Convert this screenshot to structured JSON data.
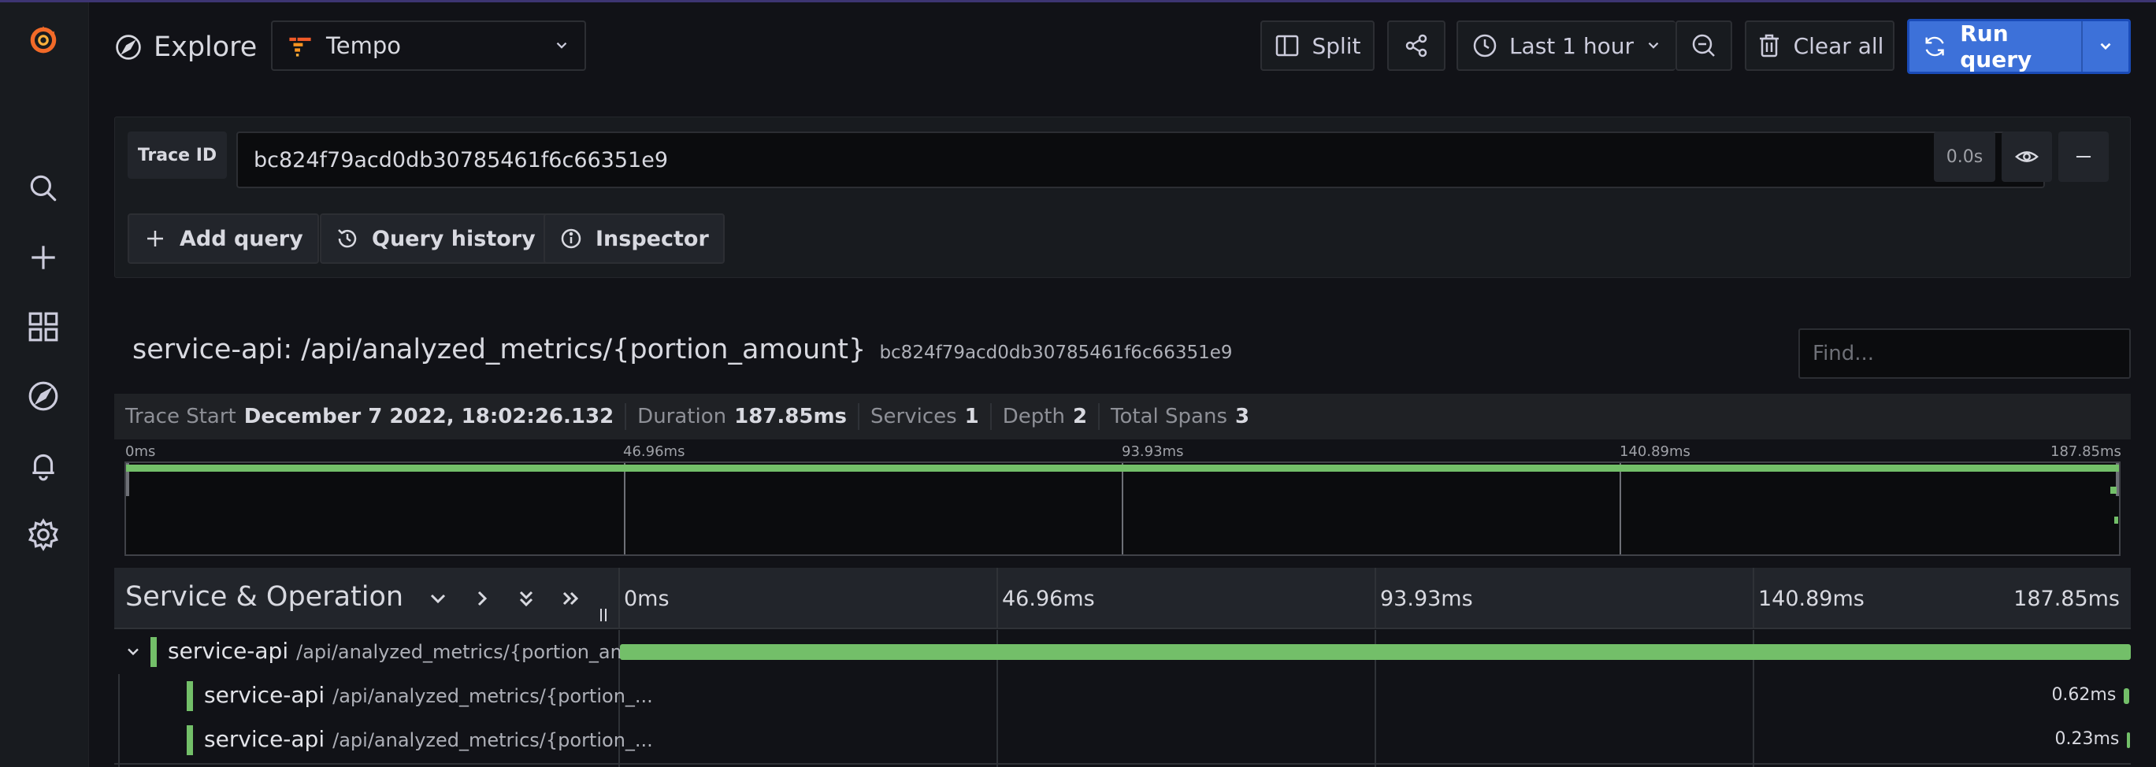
{
  "header": {
    "title": "Explore",
    "datasource": "Tempo",
    "split_label": "Split",
    "time_range": "Last 1 hour",
    "clear_all_label": "Clear all",
    "run_query_label": "Run query"
  },
  "query": {
    "field_label": "Trace ID",
    "trace_id": "bc824f79acd0db30785461f6c66351e9",
    "duration": "0.0s",
    "add_query_label": "Add query",
    "query_history_label": "Query history",
    "inspector_label": "Inspector"
  },
  "trace": {
    "service_title": "service-api: /api/analyzed_metrics/{portion_amount}",
    "trace_id": "bc824f79acd0db30785461f6c66351e9",
    "find_placeholder": "Find...",
    "meta": {
      "start_label": "Trace Start",
      "start_value": "December 7 2022, 18:02:26.132",
      "duration_label": "Duration",
      "duration_value": "187.85ms",
      "services_label": "Services",
      "services_value": "1",
      "depth_label": "Depth",
      "depth_value": "2",
      "spans_label": "Total Spans",
      "spans_value": "3"
    },
    "minimap_ticks": [
      "0ms",
      "46.96ms",
      "93.93ms",
      "140.89ms",
      "187.85ms"
    ],
    "waterfall_header": "Service & Operation",
    "waterfall_ticks": [
      "0ms",
      "46.96ms",
      "93.93ms",
      "140.89ms",
      "187.85ms"
    ],
    "total_ms": 187.85,
    "spans": [
      {
        "service": "service-api",
        "operation": "/api/analyzed_metrics/{portion_am...",
        "start_ms": 0,
        "duration_ms": 187.85,
        "duration_label": "",
        "depth": 0
      },
      {
        "service": "service-api",
        "operation": "/api/analyzed_metrics/{portion_...",
        "start_ms": 187.0,
        "duration_ms": 0.62,
        "duration_label": "0.62ms",
        "depth": 1
      },
      {
        "service": "service-api",
        "operation": "/api/analyzed_metrics/{portion_...",
        "start_ms": 187.4,
        "duration_ms": 0.23,
        "duration_label": "0.23ms",
        "depth": 1
      }
    ]
  },
  "colors": {
    "accent": "#3d71d9",
    "span": "#73bf69",
    "logo": "#f05a28"
  },
  "icons": {
    "logo": "grafana-logo-icon",
    "nav": [
      "search-icon",
      "plus-icon",
      "dashboards-icon",
      "explore-icon",
      "alert-bell-icon",
      "gear-icon"
    ]
  }
}
